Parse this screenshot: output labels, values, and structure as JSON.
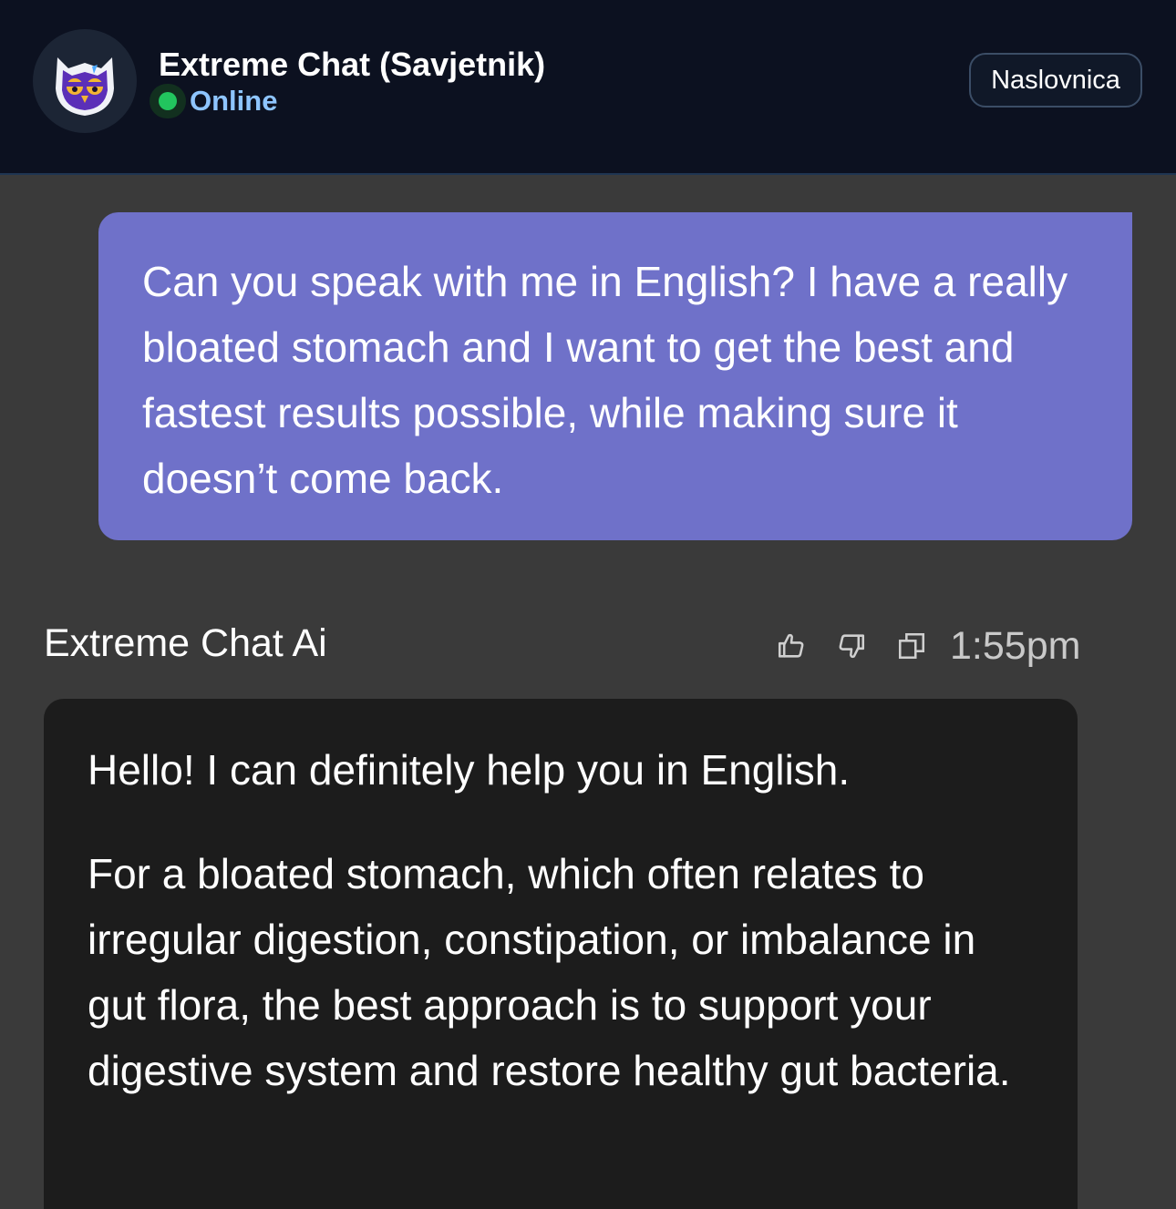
{
  "header": {
    "title": "Extreme Chat (Savjetnik)",
    "status": "Online",
    "home_button": "Naslovnica",
    "avatar_icon": "owl-avatar-icon",
    "status_color": "#22c55e"
  },
  "messages": {
    "user": {
      "text": "Can you speak with me in English? I have a really bloated stomach and I want to get the best and fastest results possible, while making sure it doesn’t come back.",
      "bubble_color": "#6f71c9"
    },
    "bot": {
      "name": "Extreme Chat Ai",
      "time": "1:55pm",
      "actions": [
        "thumbs-up-icon",
        "thumbs-down-icon",
        "copy-icon"
      ],
      "paragraphs": [
        "Hello! I can definitely help you in English.",
        "For a bloated stomach, which often relates to irregular digestion, constipation, or imbalance in gut flora, the best approach is to support your digestive system and restore healthy gut bacteria."
      ]
    }
  }
}
